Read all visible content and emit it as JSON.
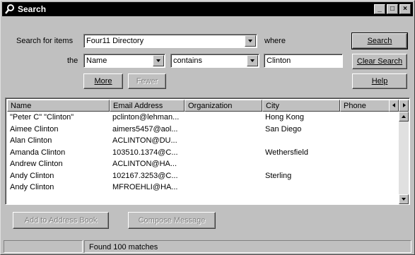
{
  "window": {
    "title": "Search",
    "minimize_label": "_",
    "maximize_label": "□",
    "close_label": "×"
  },
  "criteria": {
    "search_for_label": "Search for items",
    "directory_value": "Four11 Directory",
    "where_label": "where",
    "the_label": "the",
    "field_value": "Name",
    "operator_value": "contains",
    "query_value": "Clinton"
  },
  "buttons": {
    "more": "More",
    "fewer": "Fewer",
    "search": "Search",
    "clear_search": "Clear Search",
    "help": "Help",
    "add_to_address_book": "Add to Address Book",
    "compose_message": "Compose Message"
  },
  "results": {
    "columns": [
      "Name",
      "Email Address",
      "Organization",
      "City",
      "Phone"
    ],
    "rows": [
      [
        "\"Peter C\" \"Clinton\"",
        "pclinton@lehman...",
        "",
        "Hong Kong",
        ""
      ],
      [
        "Aimee Clinton",
        "aimers5457@aol...",
        "",
        "San Diego",
        ""
      ],
      [
        "Alan  Clinton",
        "ACLINTON@DU...",
        "",
        "",
        ""
      ],
      [
        "Amanda Clinton",
        "103510.1374@C...",
        "",
        "Wethersfield",
        ""
      ],
      [
        "Andrew  Clinton",
        "ACLINTON@HA...",
        "",
        "",
        ""
      ],
      [
        "Andy Clinton",
        "102167.3253@C...",
        "",
        "Sterling",
        ""
      ],
      [
        "Andy  Clinton",
        "MFROEHLI@HA...",
        "",
        "",
        ""
      ]
    ]
  },
  "status": {
    "message": "Found 100 matches"
  },
  "colors": {
    "titlebar": "#000000",
    "face": "#c0c0c0",
    "disabled_text": "#808080"
  }
}
